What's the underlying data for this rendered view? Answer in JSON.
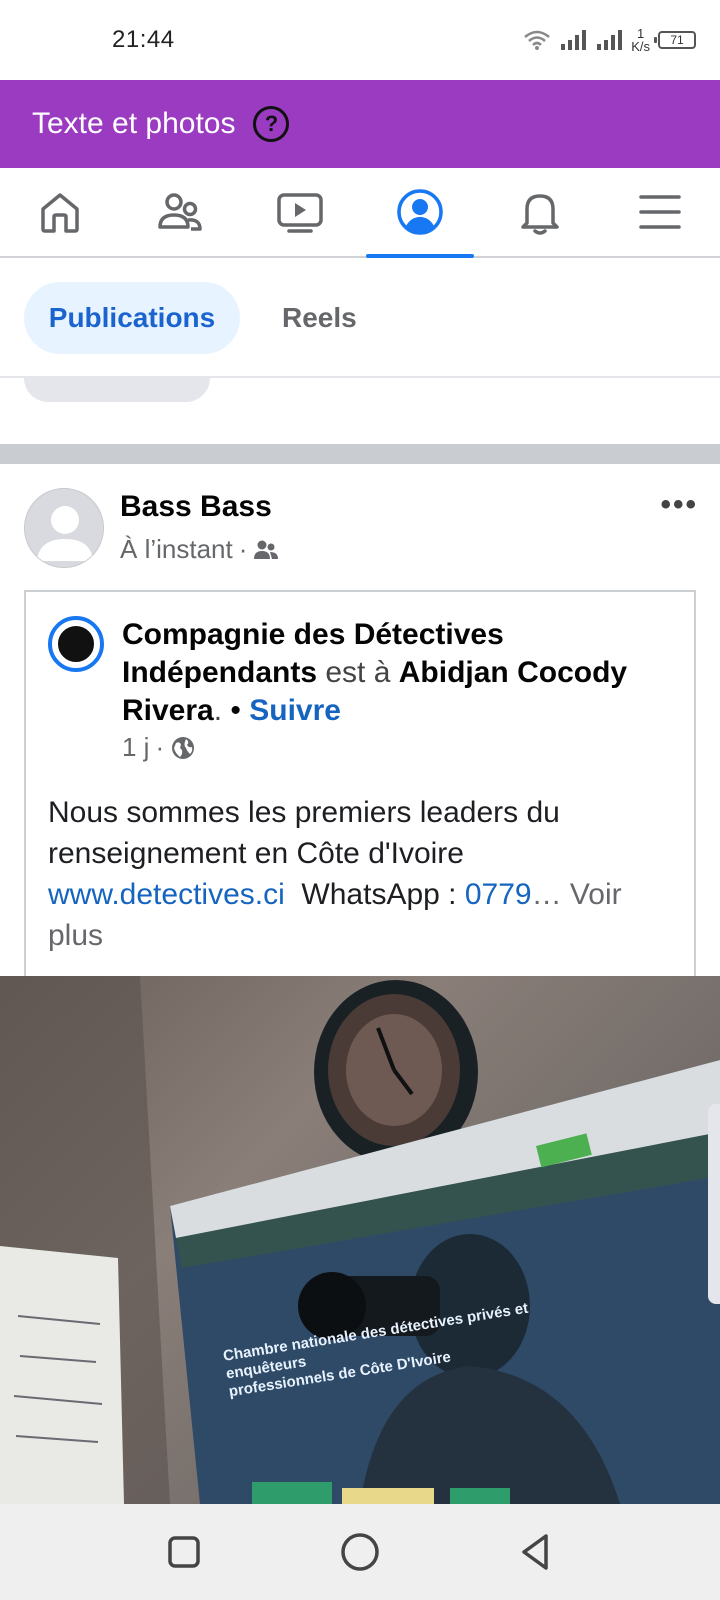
{
  "status_bar": {
    "time": "21:44",
    "speed_value": "1",
    "speed_unit": "K/s",
    "battery": "71"
  },
  "header": {
    "title": "Texte et photos",
    "help_symbol": "?"
  },
  "nav": {
    "items": [
      {
        "icon": "home-icon"
      },
      {
        "icon": "friends-icon"
      },
      {
        "icon": "video-icon"
      },
      {
        "icon": "profile-icon",
        "active": true
      },
      {
        "icon": "bell-icon"
      },
      {
        "icon": "menu-icon"
      }
    ],
    "accent": "#1877f2"
  },
  "tabs": {
    "publications": "Publications",
    "reels": "Reels"
  },
  "post": {
    "author": "Bass Bass",
    "time": "À l’instant",
    "more": "•••",
    "shared": {
      "page_name": "Compagnie des Détectives Indépendants",
      "location_prefix": "est à",
      "location": "Abidjan Cocody Rivera",
      "follow": "Suivre",
      "time": "1 j",
      "body_text": "Nous sommes les premiers leaders du renseignement en Côte d'Ivoire",
      "link": "www.detectives.ci",
      "whatsapp_label": "WhatsApp :",
      "phone": "0779",
      "see_more": "… Voir plus"
    },
    "photo": {
      "caption_line1": "Chambre nationale des détectives privés et enquêteurs",
      "caption_line2": "professionnels de Côte D'Ivoire"
    }
  },
  "colors": {
    "header_bg": "#9b3bc1",
    "link": "#1565c0",
    "tab_active_bg": "#e7f3ff"
  }
}
